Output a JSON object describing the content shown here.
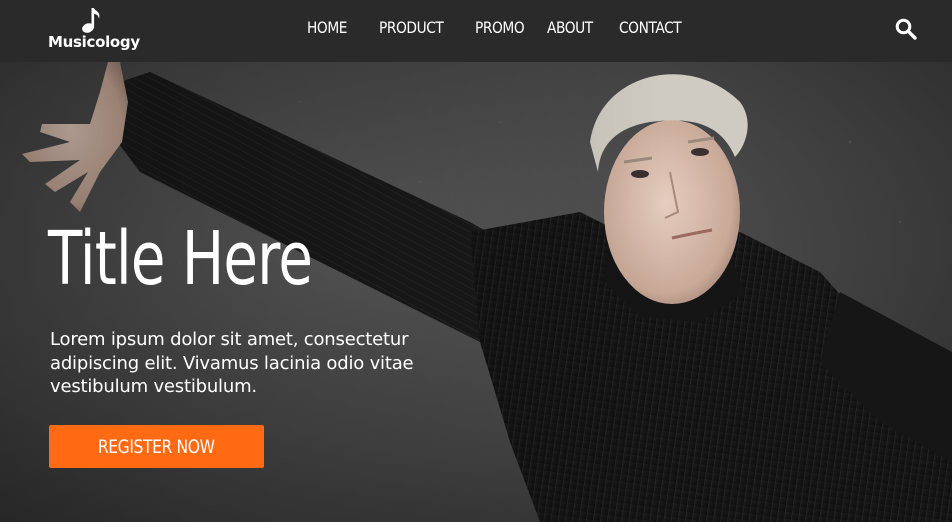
{
  "brand": {
    "name": "Musicology",
    "logo_icon": "music-note-icon"
  },
  "nav": {
    "items": [
      {
        "label": "HOME"
      },
      {
        "label": "PRODUCT"
      },
      {
        "label": "PROMO"
      },
      {
        "label": "ABOUT"
      },
      {
        "label": "CONTACT"
      }
    ],
    "search_icon": "search-icon"
  },
  "hero": {
    "title": "Title Here",
    "text": "Lorem ipsum dolor sit amet, consectetur adipiscing elit. Vivamus lacinia odio vitae vestibulum vestibulum.",
    "cta_label": "REGISTER NOW"
  },
  "colors": {
    "nav_background": "#2a2a2a",
    "accent": "#ff6a12",
    "text": "#ffffff"
  }
}
